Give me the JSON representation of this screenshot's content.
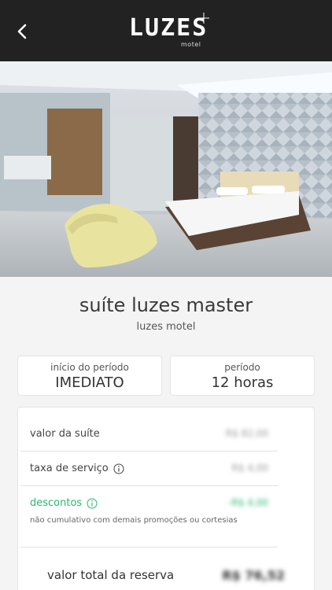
{
  "header": {
    "logo_text": "LUZES",
    "logo_sub": "motel",
    "back_icon": "chevron-left-icon",
    "background": "#222222"
  },
  "gallery": {
    "image_count": 13,
    "active_index": 0
  },
  "suite": {
    "name": "suíte luzes master",
    "motel": "luzes motel"
  },
  "period": {
    "start_label": "início do período",
    "start_value": "IMEDIATO",
    "length_label": "período",
    "length_value": "12 horas"
  },
  "pricing": {
    "suite_label": "valor da suíte",
    "suite_value": "R$ 82,00",
    "service_label": "taxa de serviço",
    "service_value": "R$ 4,00",
    "discount_label": "descontos",
    "discount_value": "-R$ 4,00",
    "discount_note": "não cumulativo com demais promoções ou cortesias",
    "total_label": "valor total da reserva",
    "total_value": "R$ 76,52",
    "discount_color": "#2bb673"
  }
}
